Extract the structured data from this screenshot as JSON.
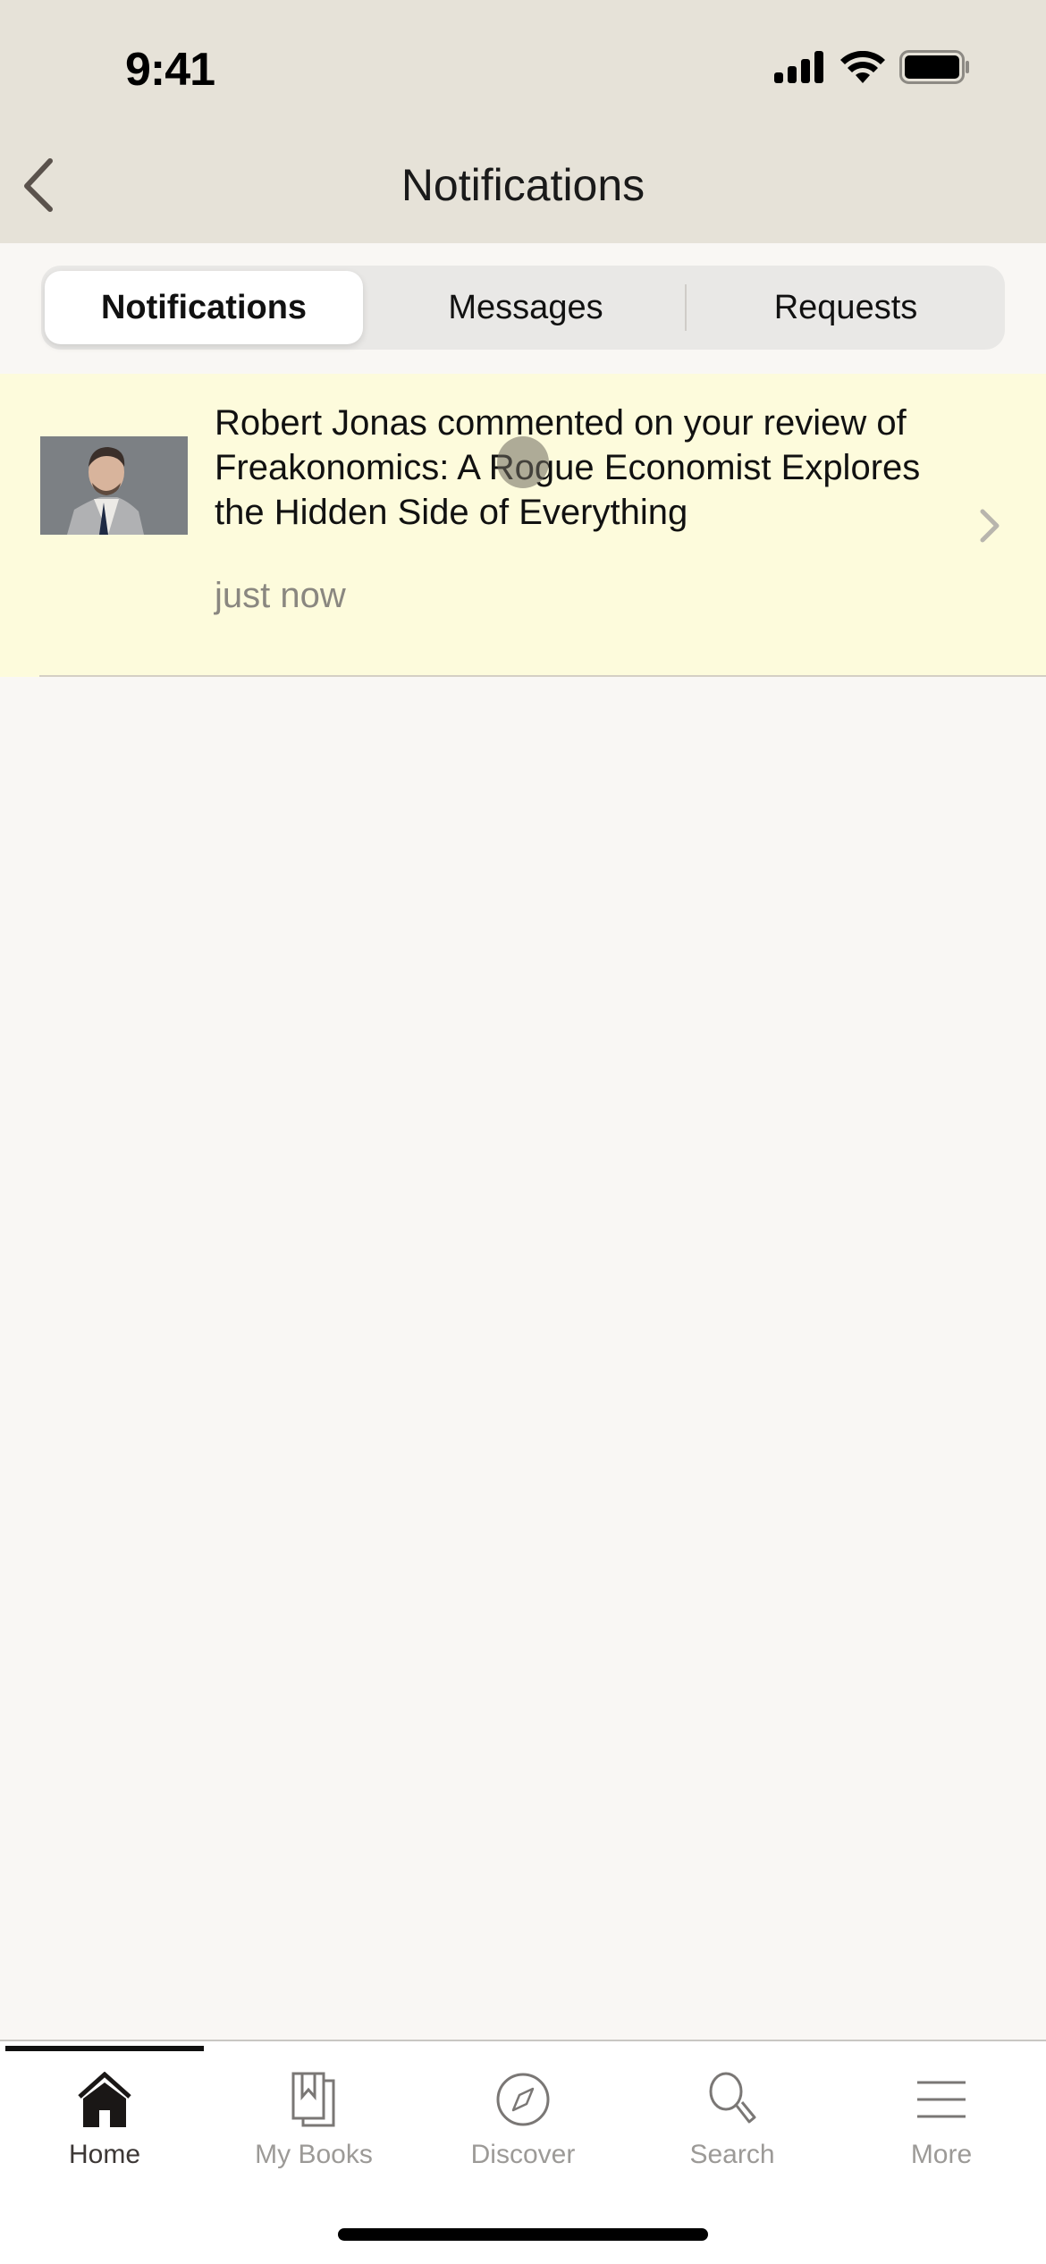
{
  "status_bar": {
    "time": "9:41",
    "icons": [
      "cellular-signal-icon",
      "wifi-icon",
      "battery-icon"
    ]
  },
  "nav": {
    "back_icon": "chevron-left-icon",
    "title": "Notifications"
  },
  "segments": [
    {
      "label": "Notifications",
      "active": true
    },
    {
      "label": "Messages",
      "active": false
    },
    {
      "label": "Requests",
      "active": false
    }
  ],
  "notifications": [
    {
      "avatar": "user-photo-robert-jonas",
      "text": "Robert Jonas commented on your review of Freakonomics: A Rogue Economist Explores the Hidden Side of Everything",
      "time": "just now",
      "chevron": "chevron-right-icon"
    }
  ],
  "colors": {
    "header_bg": "#E6E2D8",
    "page_bg": "#F9F7F4",
    "unread_bg": "#FDFBDC",
    "muted_text": "#8A8780"
  },
  "tabbar": {
    "items": [
      {
        "label": "Home",
        "icon": "home-icon",
        "active": true
      },
      {
        "label": "My Books",
        "icon": "books-icon",
        "active": false
      },
      {
        "label": "Discover",
        "icon": "compass-icon",
        "active": false
      },
      {
        "label": "Search",
        "icon": "search-icon",
        "active": false
      },
      {
        "label": "More",
        "icon": "menu-icon",
        "active": false
      }
    ]
  }
}
